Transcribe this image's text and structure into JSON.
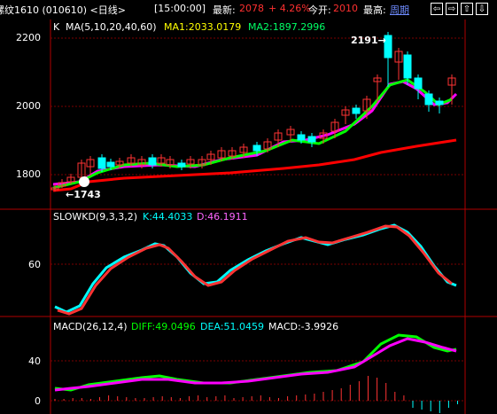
{
  "topbar": {
    "title": "螺纹1610 (010610) <日线>",
    "time": "[15:00:00]",
    "latest_label": "最新:",
    "latest_value": "2078",
    "change": "+ 4.26%",
    "open_label": "今开:",
    "open_value": "2010",
    "high_label": "最高:",
    "period_link": "周期",
    "nav": [
      "⇦",
      "⇨",
      "⇧",
      "⇩"
    ]
  },
  "colors": {
    "up": "#ff3333",
    "down": "#00ffff",
    "ma5": "#ffffff",
    "ma10": "#ffff00",
    "ma20": "#ff00ff",
    "ma40": "#00ff00",
    "ma60": "#ff0000",
    "grid": "#7a0000",
    "k_line": "#00ffff",
    "d_line": "#ff3333",
    "diff_line": "#00ff00",
    "dea_line": "#ff00ff"
  },
  "main": {
    "legend_k": "K",
    "legend_ma": "MA(5,10,20,40,60)",
    "ma1": "MA1:2033.0179",
    "ma2": "MA2:1897.2996",
    "peak_label": "2191→",
    "low_label": "←1743",
    "y_ticks": [
      "2200",
      "2000",
      "1800"
    ]
  },
  "kd": {
    "label": "SLOWKD(9,3,3,2)",
    "k": "K:44.4033",
    "d": "D:46.1911",
    "y_ticks": [
      "60"
    ]
  },
  "macd": {
    "label": "MACD(26,12,4)",
    "diff": "DIFF:49.0496",
    "dea": "DEA:51.0459",
    "macd": "MACD:-3.9926",
    "y_ticks": [
      "40",
      "0"
    ]
  }
}
